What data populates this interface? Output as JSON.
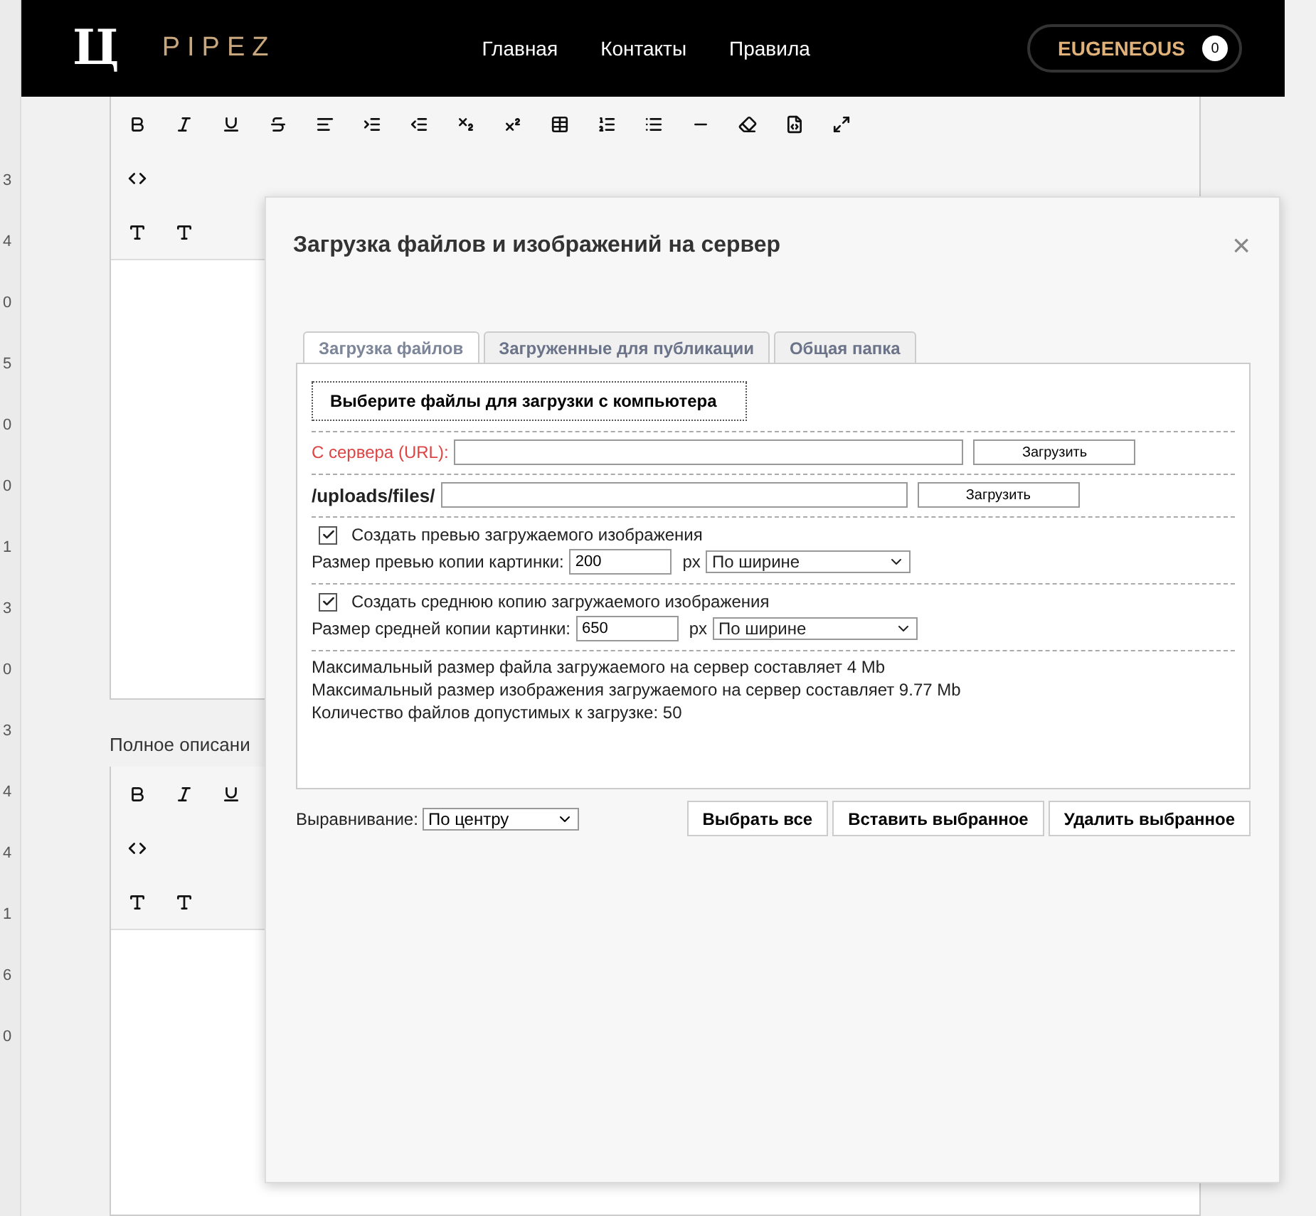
{
  "header": {
    "logo_mark": "Ц",
    "brand": "PIPEZ",
    "nav": [
      "Главная",
      "Контакты",
      "Правила"
    ],
    "user": {
      "name": "EUGENEOUS",
      "count": "0"
    }
  },
  "side_numbers": [
    "3",
    "4",
    "0",
    "5",
    "0",
    "0",
    "1",
    "3",
    "0",
    "3",
    "4",
    "4",
    "1",
    "6",
    "0"
  ],
  "editor_label": "Полное описани",
  "modal": {
    "title": "Загрузка файлов и изображений на сервер",
    "close": "×",
    "tabs": [
      {
        "label": "Загрузка файлов",
        "selected": true
      },
      {
        "label": "Загруженные для публикации",
        "selected": false
      },
      {
        "label": "Общая папка",
        "selected": false
      }
    ],
    "choose_button": "Выберите файлы для загрузки с компьютера",
    "url_row": {
      "label": "С сервера (URL):",
      "button": "Загрузить"
    },
    "path_row": {
      "label": "/uploads/files/",
      "button": "Загрузить"
    },
    "options": [
      {
        "checked": true,
        "label": "Создать превью загружаемого изображения",
        "size_label": "Размер превью копии картинки:",
        "value": "200",
        "unit": "px",
        "mode": "По ширине"
      },
      {
        "checked": true,
        "label": "Создать среднюю копию загружаемого изображения",
        "size_label": "Размер средней копии картинки:",
        "value": "650",
        "unit": "px",
        "mode": "По ширине"
      }
    ],
    "info": [
      "Максимальный размер файла загружаемого на сервер составляет 4 Mb",
      "Максимальный размер изображения загружаемого на сервер составляет 9.77 Mb",
      "Количество файлов допустимых к загрузке: 50"
    ],
    "alignment": {
      "label": "Выравнивание:",
      "value": "По центру"
    },
    "actions": [
      "Выбрать все",
      "Вставить выбранное",
      "Удалить выбранное"
    ]
  }
}
